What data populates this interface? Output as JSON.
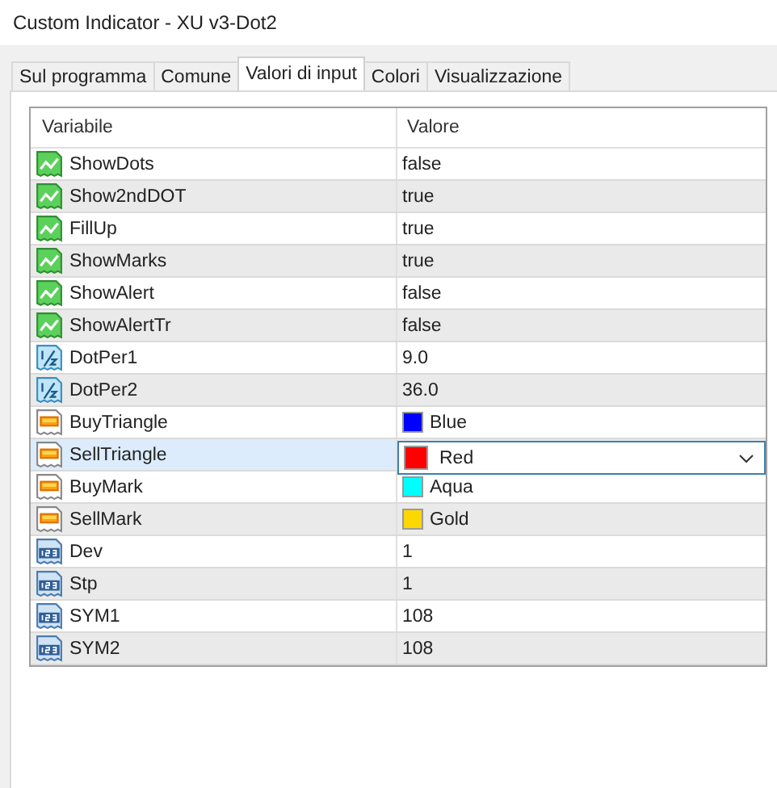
{
  "window": {
    "title": "Custom Indicator - XU v3-Dot2"
  },
  "tabs": [
    {
      "label": "Sul programma",
      "selected": false
    },
    {
      "label": "Comune",
      "selected": false
    },
    {
      "label": "Valori di input",
      "selected": true
    },
    {
      "label": "Colori",
      "selected": false
    },
    {
      "label": "Visualizzazione",
      "selected": false
    }
  ],
  "table": {
    "columns": [
      "Variabile",
      "Valore"
    ],
    "rows": [
      {
        "kind": "bool",
        "name": "ShowDots",
        "value": "false",
        "selected": false
      },
      {
        "kind": "bool",
        "name": "Show2ndDOT",
        "value": "true",
        "selected": false
      },
      {
        "kind": "bool",
        "name": "FillUp",
        "value": "true",
        "selected": false
      },
      {
        "kind": "bool",
        "name": "ShowMarks",
        "value": "true",
        "selected": false
      },
      {
        "kind": "bool",
        "name": "ShowAlert",
        "value": "false",
        "selected": false
      },
      {
        "kind": "bool",
        "name": "ShowAlertTr",
        "value": "false",
        "selected": false
      },
      {
        "kind": "double",
        "name": "DotPer1",
        "value": "9.0",
        "selected": false
      },
      {
        "kind": "double",
        "name": "DotPer2",
        "value": "36.0",
        "selected": false
      },
      {
        "kind": "color",
        "name": "BuyTriangle",
        "value": "Blue",
        "color": "#0000ff",
        "selected": false
      },
      {
        "kind": "color",
        "name": "SellTriangle",
        "value": "Red",
        "color": "#ff0000",
        "selected": true
      },
      {
        "kind": "color",
        "name": "BuyMark",
        "value": "Aqua",
        "color": "#00ffff",
        "selected": false
      },
      {
        "kind": "color",
        "name": "SellMark",
        "value": "Gold",
        "color": "#ffd700",
        "selected": false
      },
      {
        "kind": "int",
        "name": "Dev",
        "value": "1",
        "selected": false
      },
      {
        "kind": "int",
        "name": "Stp",
        "value": "1",
        "selected": false
      },
      {
        "kind": "int",
        "name": "SYM1",
        "value": "108",
        "selected": false
      },
      {
        "kind": "int",
        "name": "SYM2",
        "value": "108",
        "selected": false
      }
    ]
  }
}
